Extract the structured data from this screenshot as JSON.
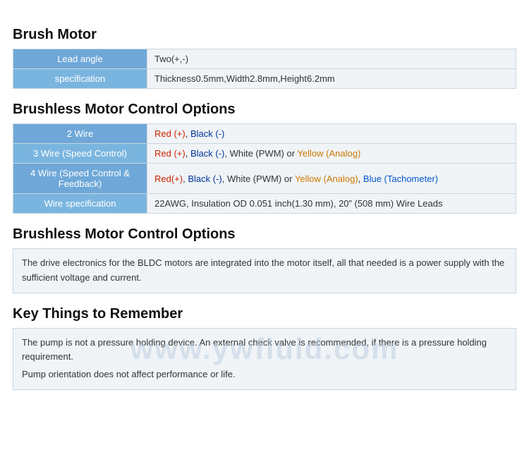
{
  "brush_motor": {
    "title": "Brush Motor",
    "rows": [
      {
        "label": "Lead angle",
        "value_text": "Two(+,-)",
        "value_parts": [
          {
            "text": "Two(+,-)",
            "color": "plain"
          }
        ]
      },
      {
        "label": "specification",
        "value_text": "Thickness0.5mm,Width2.8mm,Height6.2mm",
        "value_parts": [
          {
            "text": "Thickness0.5mm,Width2.8mm,Height6.2mm",
            "color": "plain"
          }
        ]
      }
    ]
  },
  "brushless_control": {
    "title": "Brushless Motor Control Options",
    "rows": [
      {
        "label": "2 Wire",
        "value_html": "Red (+), Black (-)"
      },
      {
        "label": "3 Wire (Speed Control)",
        "value_html": "Red (+), Black (-), White (PWM) or Yellow (Analog)"
      },
      {
        "label": "4 Wire (Speed Control & Feedback)",
        "value_html": "Red(+), Black (-), White (PWM) or Yellow (Analog), Blue (Tachometer)"
      },
      {
        "label": "Wire specification",
        "value_html": "22AWG, Insulation OD 0.051 inch(1.30 mm), 20\" (508 mm) Wire Leads"
      }
    ]
  },
  "brushless_desc": {
    "title": "Brushless Motor Control Options",
    "text": "The drive electronics for the BLDC motors are integrated into the motor itself, all that needed is a power supply with the sufficient voltage and current."
  },
  "key_things": {
    "title": "Key Things to Remember",
    "lines": [
      "The pump is not a pressure holding device. An external check valve is recommended, if there is a pressure holding requirement.",
      "Pump orientation does not affect performance or life."
    ]
  },
  "watermark": {
    "text": "www.ywfluid.com"
  }
}
